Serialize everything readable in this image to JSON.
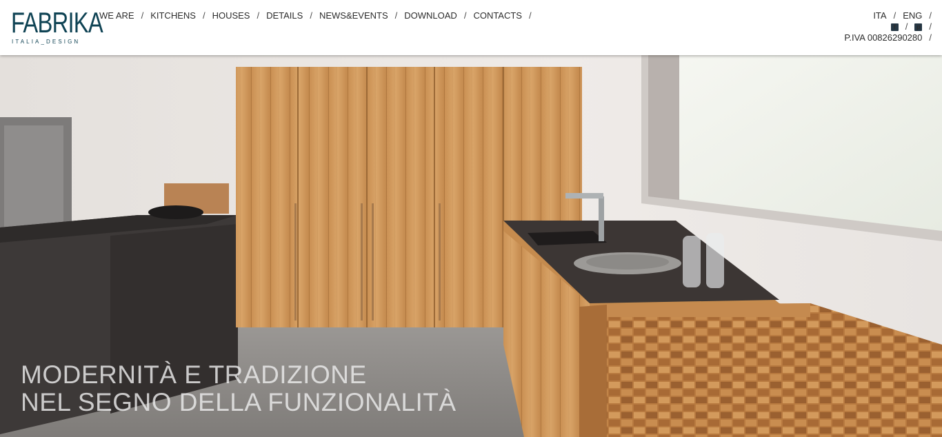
{
  "logo": {
    "main": "FABRIKA",
    "sub": "ITALIA_DESIGN"
  },
  "nav": {
    "items": [
      "WE ARE",
      "KITCHENS",
      "HOUSES",
      "DETAILS",
      "NEWS&EVENTS",
      "DOWNLOAD",
      "CONTACTS"
    ],
    "separator": "/"
  },
  "lang": {
    "ita": "ITA",
    "eng": "ENG"
  },
  "social": {
    "facebook": "facebook-icon",
    "pinterest": "pinterest-icon"
  },
  "vat": "P.IVA 00826290280",
  "hero": {
    "line1": "MODERNITÀ E TRADIZIONE",
    "line2": "NEL SEGNO DELLA FUNZIONALITÀ"
  }
}
